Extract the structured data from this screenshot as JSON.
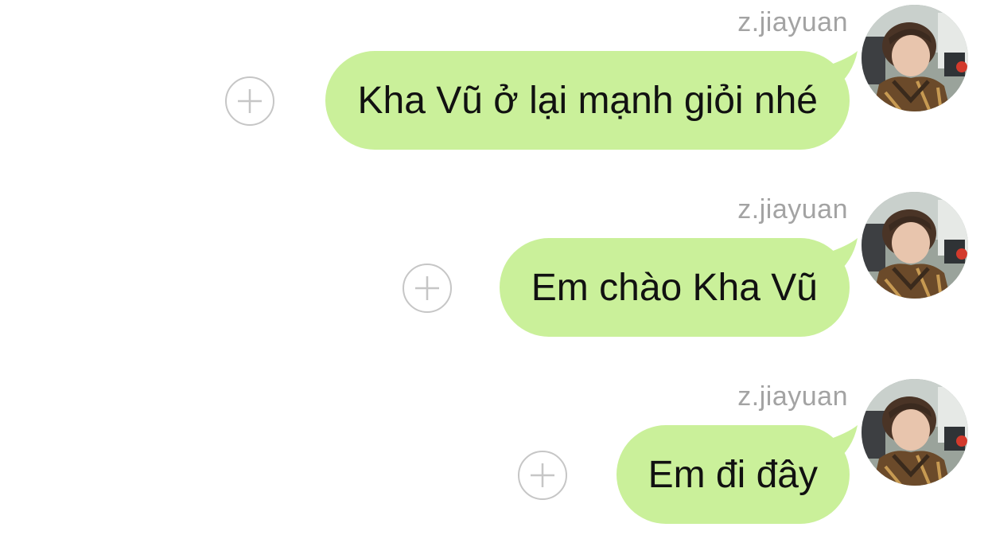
{
  "conversation": {
    "messages": [
      {
        "sender": "z.jiayuan",
        "text": "Kha Vũ ở lại mạnh giỏi nhé"
      },
      {
        "sender": "z.jiayuan",
        "text": "Em chào Kha Vũ"
      },
      {
        "sender": "z.jiayuan",
        "text": "Em đi đây"
      }
    ]
  },
  "icons": {
    "add": "plus-circle-icon",
    "avatar": "profile-photo"
  },
  "colors": {
    "outgoing_bubble": "#caf09a",
    "sender_name": "#a3a3a3",
    "add_button_stroke": "#c6c6c6",
    "message_text": "#111111"
  }
}
